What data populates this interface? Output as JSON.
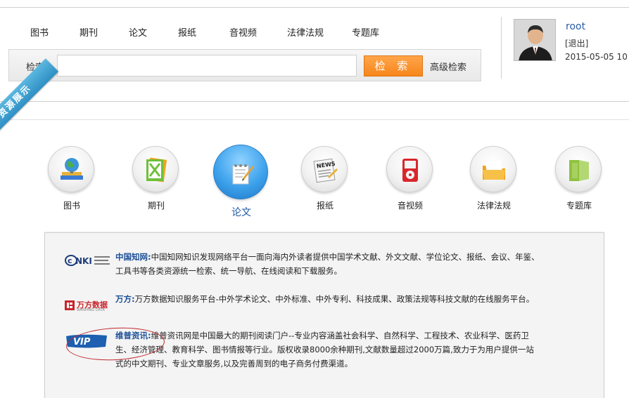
{
  "nav": {
    "items": [
      "图书",
      "期刊",
      "论文",
      "报纸",
      "音视频",
      "法律法规",
      "专题库"
    ]
  },
  "search": {
    "label": "检索:",
    "placeholder": "",
    "button_label": "检 索",
    "advanced_label": "高级检索"
  },
  "user": {
    "name": "root",
    "logout_label": "[退出]",
    "date": "2015-05-05 10"
  },
  "ribbon": {
    "text": "资源展示"
  },
  "categories": [
    {
      "label": "图书",
      "icon": "globe-books-icon",
      "active": false
    },
    {
      "label": "期刊",
      "icon": "journal-icon",
      "active": false
    },
    {
      "label": "论文",
      "icon": "paper-pen-icon",
      "active": true
    },
    {
      "label": "报纸",
      "icon": "newspaper-icon",
      "active": false
    },
    {
      "label": "音视频",
      "icon": "media-player-icon",
      "active": false
    },
    {
      "label": "法律法规",
      "icon": "law-folder-icon",
      "active": false
    },
    {
      "label": "专题库",
      "icon": "topic-folder-icon",
      "active": false
    }
  ],
  "resources": [
    {
      "logo": "cnki-logo",
      "name": "中国知网:",
      "line1": "中国知网知识发现网络平台一面向海内外读者提供中国学术文献、外文文献、学位论文、报纸、会议、年鉴、",
      "line2": "工具书等各类资源统一检索、统一导航、在线阅读和下载服务。"
    },
    {
      "logo": "wanfang-logo",
      "logo_text": "万方数据",
      "logo_subtext": "WANFANG DATA",
      "name": "万方:",
      "line1": "万方数据知识服务平台-中外学术论文、中外标准、中外专利、科技成果、政策法规等科技文献的在线服务平台。"
    },
    {
      "logo": "vip-logo",
      "name": "维普资讯:",
      "line1": "维普资讯网是中国最大的期刊阅读门户--专业内容涵盖社会科学、自然科学、工程技术、农业科学、医药卫",
      "line2": "生、经济管理、教育科学、图书情报等行业。版权收录8000余种期刊,文献数量超过2000万篇,致力于为用户提供一站",
      "line3": "式的中文期刊、专业文章服务,以及完善周到的电子商务付费渠道。"
    }
  ],
  "colors": {
    "accent_orange": "#f7861b",
    "link_blue": "#2a5da8",
    "name_blue": "#1d4f96",
    "ribbon_blue": "#3a9ed6",
    "highlight_red": "#c0262c"
  }
}
